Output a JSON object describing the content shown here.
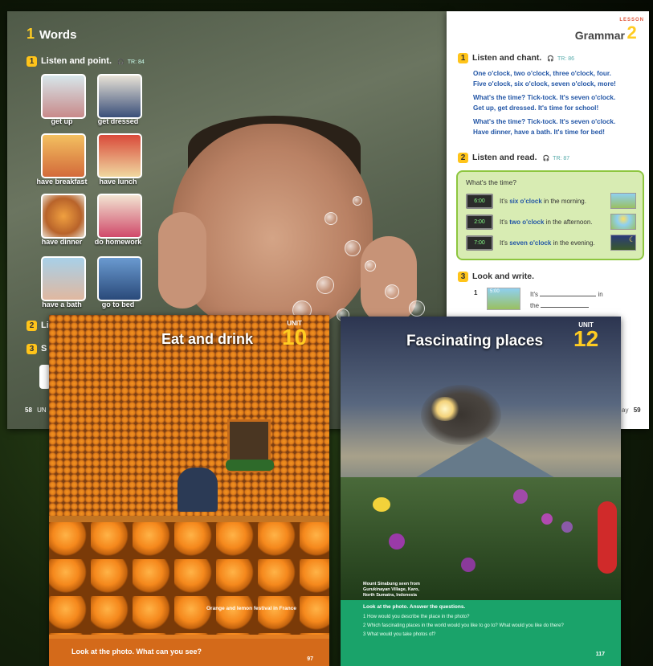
{
  "left_page": {
    "lesson_number": "1",
    "title": "Words",
    "task1": {
      "number": "1",
      "label": "Listen and point.",
      "track": "TR: 84"
    },
    "cards": [
      {
        "label": "get up"
      },
      {
        "label": "get dressed"
      },
      {
        "label": "have breakfast"
      },
      {
        "label": "have lunch"
      },
      {
        "label": "have dinner"
      },
      {
        "label": "do homework"
      },
      {
        "label": "have a bath"
      },
      {
        "label": "go to bed"
      }
    ],
    "task2": {
      "number": "2",
      "label": "Li"
    },
    "task3": {
      "number": "3",
      "label": "S"
    },
    "page_number": "58",
    "footer_fragment": "UN"
  },
  "right_page": {
    "title": "Grammar",
    "lesson_label": "LESSON",
    "lesson_number": "2",
    "task1": {
      "number": "1",
      "label": "Listen and chant.",
      "track": "TR: 86"
    },
    "chant": [
      "One o'clock, two o'clock, three o'clock, four.",
      "Five o'clock, six o'clock, seven o'clock, more!",
      "What's the time? Tick-tock. It's seven o'clock.",
      "Get up, get dressed. It's time for school!",
      "What's the time? Tick-tock. It's seven o'clock.",
      "Have dinner, have a bath. It's time for bed!"
    ],
    "task2": {
      "number": "2",
      "label": "Listen and read.",
      "track": "TR: 87"
    },
    "box_question": "What's the time?",
    "times": [
      {
        "clock": "6:00",
        "prefix": "It's ",
        "time": "six o'clock",
        "suffix": " in the morning."
      },
      {
        "clock": "2:00",
        "prefix": "It's ",
        "time": "two o'clock",
        "suffix": " in the afternoon."
      },
      {
        "clock": "7:00",
        "prefix": "It's ",
        "time": "seven o'clock",
        "suffix": " in the evening."
      }
    ],
    "task3": {
      "number": "3",
      "label": "Look and write."
    },
    "exercise": {
      "number": "1",
      "clock": "5:00",
      "line1_start": "It's",
      "line1_end": "in",
      "line2_start": "the"
    },
    "footer_fragment": "ay",
    "page_number": "59"
  },
  "cover_unit10": {
    "title": "Eat and drink",
    "unit_label": "UNIT",
    "unit_number": "10",
    "caption": "Orange and lemon festival in France",
    "prompt": "Look at the photo. What can you see?",
    "page_number": "97"
  },
  "cover_unit12": {
    "title": "Fascinating places",
    "unit_label": "UNIT",
    "unit_number": "12",
    "caption": [
      "Mount Sinabung seen from",
      "Gurukinayan Village, Karo,",
      "North Sumatra, Indonesia"
    ],
    "instruction": "Look at the photo. Answer the questions.",
    "questions": [
      "1  How would you describe the place in the photo?",
      "2  Which fascinating places in the world would you like to go to? What would you like do there?",
      "3  What would you take photos of?"
    ],
    "page_number": "117"
  },
  "colors": {
    "accent_yellow": "#ffcc22",
    "chant_blue": "#2356a6",
    "green_box": "#d8ecb3",
    "unit10_bar": "#d46a1a",
    "unit12_bar": "#1aa36a"
  }
}
